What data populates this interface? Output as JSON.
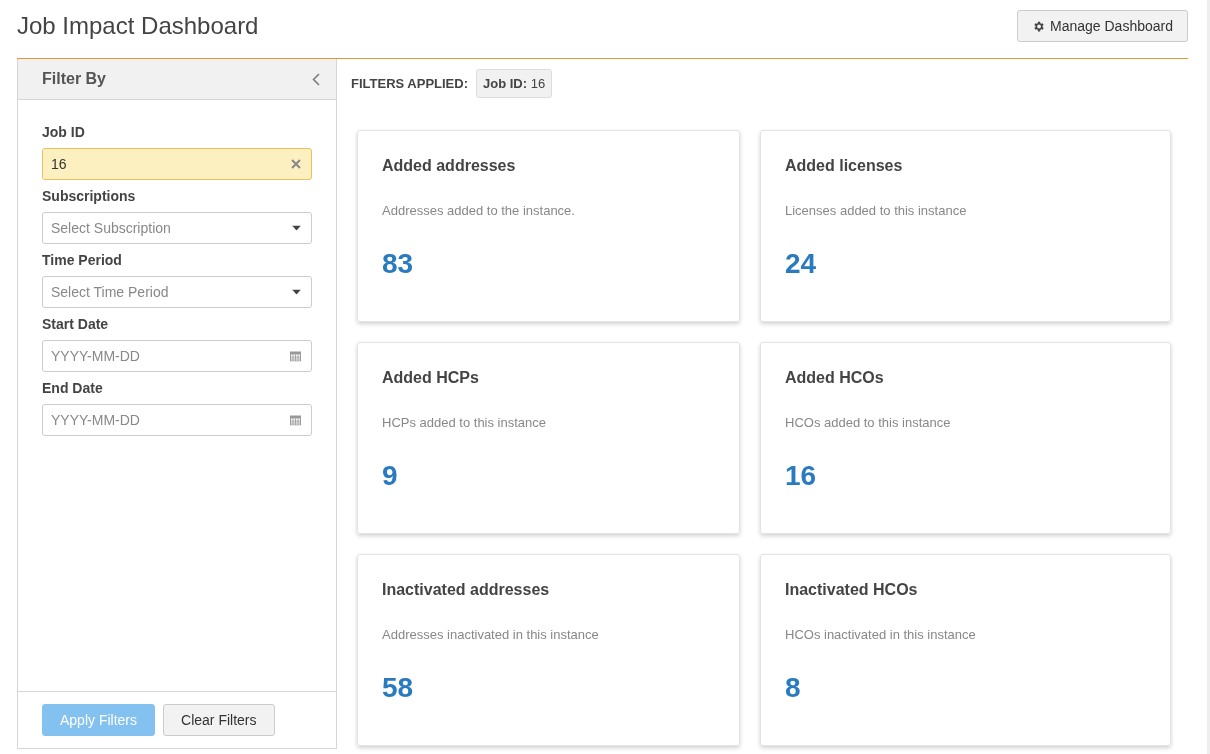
{
  "page": {
    "title": "Job Impact Dashboard"
  },
  "manage_button": {
    "label": "Manage Dashboard"
  },
  "sidebar": {
    "title": "Filter By",
    "fields": [
      {
        "kind": "text",
        "label": "Job ID",
        "value": "16",
        "highlighted": true
      },
      {
        "kind": "select",
        "label": "Subscriptions",
        "placeholder": "Select Subscription"
      },
      {
        "kind": "select",
        "label": "Time Period",
        "placeholder": "Select Time Period"
      },
      {
        "kind": "date",
        "label": "Start Date",
        "placeholder": "YYYY-MM-DD"
      },
      {
        "kind": "date",
        "label": "End Date",
        "placeholder": "YYYY-MM-DD"
      }
    ],
    "buttons": [
      {
        "label": "Apply Filters",
        "kind": "primary",
        "disabled": true
      },
      {
        "label": "Clear Filters",
        "kind": "default",
        "disabled": false
      }
    ]
  },
  "filters_applied": {
    "label": "FILTERS APPLIED:",
    "chips": [
      {
        "key": "Job ID:",
        "value": "16"
      }
    ]
  },
  "cards": [
    {
      "title": "Added addresses",
      "description": "Addresses added to the instance.",
      "value": "83"
    },
    {
      "title": "Added licenses",
      "description": "Licenses added to this instance",
      "value": "24"
    },
    {
      "title": "Added HCPs",
      "description": "HCPs added to this instance",
      "value": "9"
    },
    {
      "title": "Added HCOs",
      "description": "HCOs added to this instance",
      "value": "16"
    },
    {
      "title": "Inactivated addresses",
      "description": "Addresses inactivated in this instance",
      "value": "58"
    },
    {
      "title": "Inactivated HCOs",
      "description": "HCOs inactivated in this instance",
      "value": "8"
    }
  ]
}
